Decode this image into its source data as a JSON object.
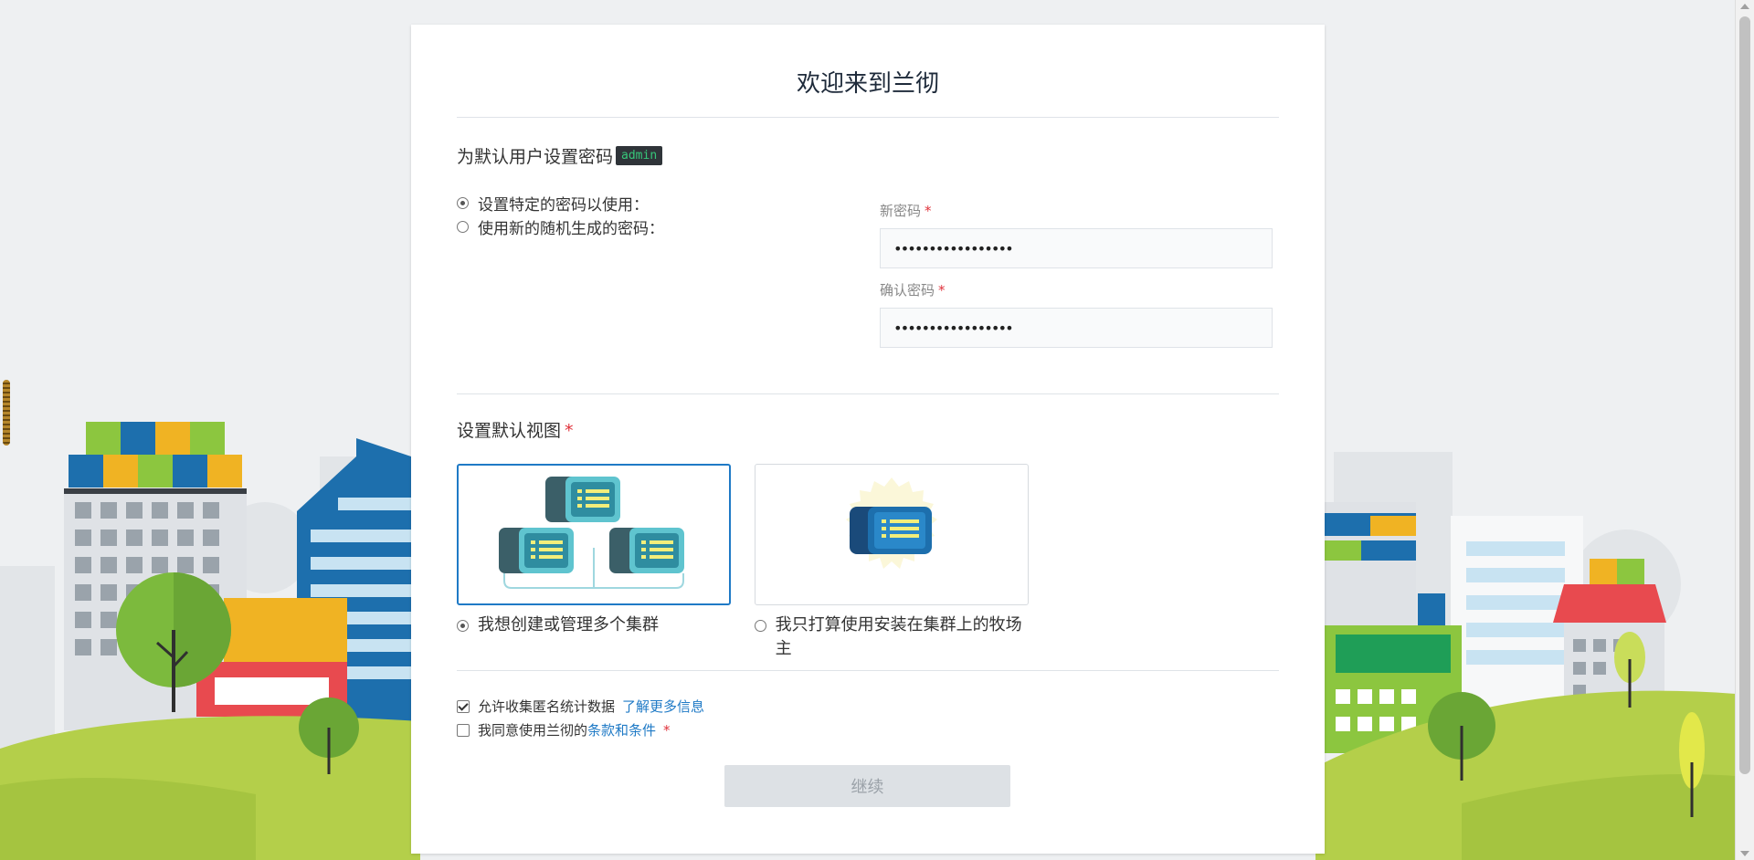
{
  "page": {
    "title": "欢迎来到兰彻"
  },
  "password_section": {
    "heading": "为默认用户设置密码",
    "default_user": "admin",
    "options": [
      {
        "label": "设置特定的密码以使用：",
        "selected": true
      },
      {
        "label": "使用新的随机生成的密码：",
        "selected": false
      }
    ],
    "new_password": {
      "label": "新密码",
      "required_mark": "*",
      "value": "•••••••••••••••••"
    },
    "confirm_password": {
      "label": "确认密码",
      "required_mark": "*",
      "value": "•••••••••••••••••"
    }
  },
  "view_section": {
    "heading": "设置默认视图",
    "required_mark": "*",
    "options": [
      {
        "label": "我想创建或管理多个集群",
        "selected": true,
        "icon": "multi-cluster-icon"
      },
      {
        "label": "我只打算使用安装在集群上的牧场主",
        "selected": false,
        "icon": "single-cluster-icon"
      }
    ]
  },
  "agreements": {
    "telemetry_label": "允许收集匿名统计数据",
    "telemetry_checked": true,
    "telemetry_link": "了解更多信息",
    "terms_prefix": "我同意使用兰彻的",
    "terms_link": "条款和条件",
    "terms_checked": false,
    "required_mark": "*"
  },
  "actions": {
    "continue_label": "继续",
    "continue_enabled": false
  },
  "colors": {
    "accent": "#1f7ac6",
    "required": "#e0323b",
    "button_disabled_bg": "#dde1e5"
  }
}
